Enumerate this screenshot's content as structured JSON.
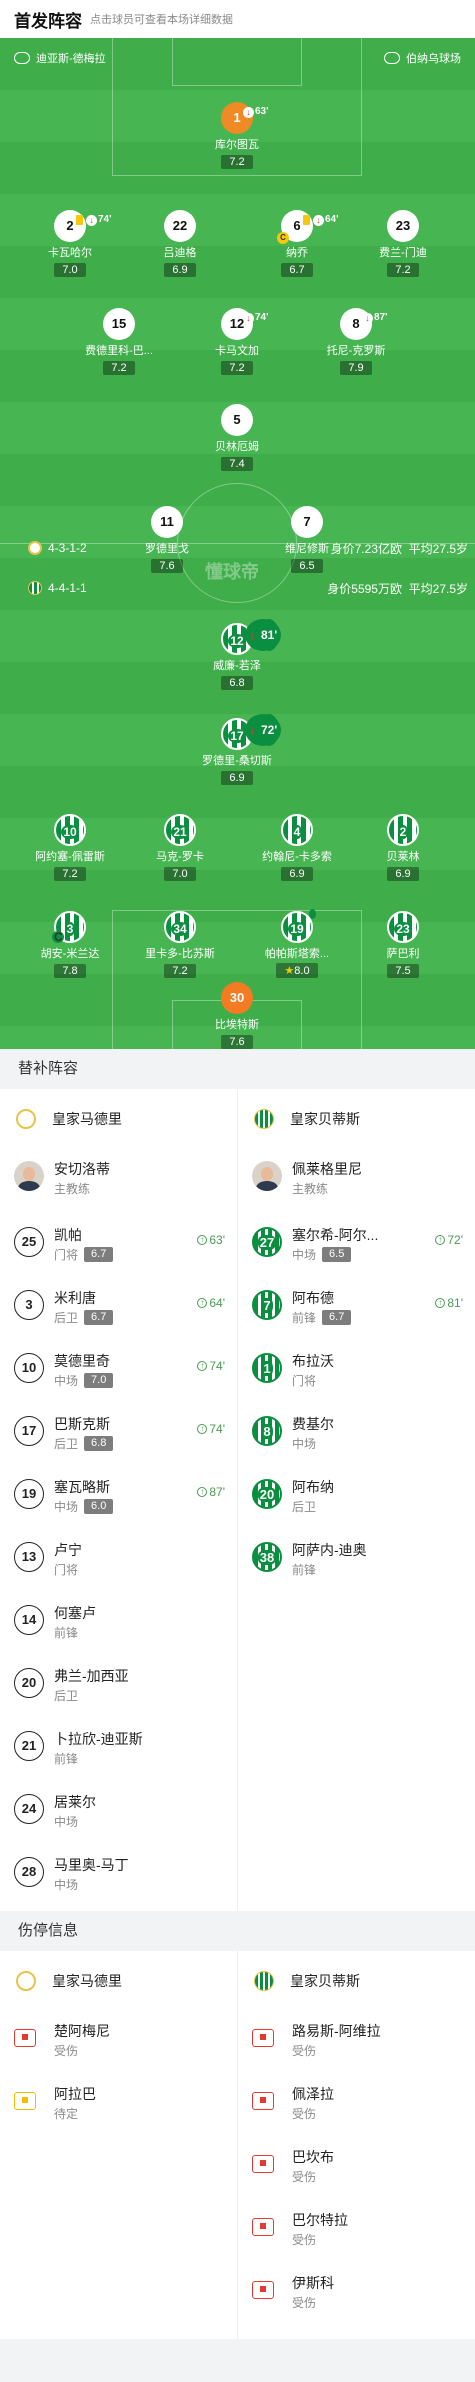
{
  "header": {
    "title": "首发阵容",
    "hint": "点击球员可查看本场详细数据"
  },
  "venues": {
    "left": "迪亚斯-德梅拉",
    "right": "伯纳乌球场"
  },
  "watermark": "懂球帝",
  "home_team": {
    "formation": "4-3-1-2",
    "value": "身价7.23亿欧",
    "age": "平均27.5岁"
  },
  "away_team": {
    "formation": "4-4-1-1",
    "value": "身价5595万欧",
    "age": "平均27.5岁"
  },
  "home_players": [
    {
      "num": "1",
      "name": "库尔图瓦",
      "rating": "7.2",
      "sub": "63'",
      "type": "gk"
    },
    {
      "num": "2",
      "name": "卡瓦哈尔",
      "rating": "7.0",
      "sub": "74'",
      "yellow": true
    },
    {
      "num": "22",
      "name": "吕迪格",
      "rating": "6.9"
    },
    {
      "num": "6",
      "name": "纳乔",
      "rating": "6.7",
      "sub": "64'",
      "yellow": true,
      "captain": "C"
    },
    {
      "num": "23",
      "name": "费兰-门迪",
      "rating": "7.2"
    },
    {
      "num": "15",
      "name": "费德里科-巴...",
      "rating": "7.2"
    },
    {
      "num": "12",
      "name": "卡马文加",
      "rating": "7.2",
      "sub": "74'"
    },
    {
      "num": "8",
      "name": "托尼-克罗斯",
      "rating": "7.9",
      "sub": "87'"
    },
    {
      "num": "5",
      "name": "贝林厄姆",
      "rating": "7.4"
    },
    {
      "num": "11",
      "name": "罗德里戈",
      "rating": "7.6"
    },
    {
      "num": "7",
      "name": "维尼修斯",
      "rating": "6.5"
    }
  ],
  "away_players": [
    {
      "num": "12",
      "name": "威廉-若泽",
      "rating": "6.8",
      "sub": "81'"
    },
    {
      "num": "17",
      "name": "罗德里-桑切斯",
      "rating": "6.9",
      "sub": "72'"
    },
    {
      "num": "10",
      "name": "阿约塞-佩雷斯",
      "rating": "7.2"
    },
    {
      "num": "21",
      "name": "马克-罗卡",
      "rating": "7.0"
    },
    {
      "num": "4",
      "name": "约翰尼-卡多索",
      "rating": "6.9"
    },
    {
      "num": "2",
      "name": "贝莱林",
      "rating": "6.9"
    },
    {
      "num": "3",
      "name": "胡安-米兰达",
      "rating": "7.8",
      "captain": "C"
    },
    {
      "num": "34",
      "name": "里卡多-比苏斯",
      "rating": "7.2"
    },
    {
      "num": "19",
      "name": "帕帕斯塔索...",
      "rating": "8.0",
      "yellow": true,
      "star": "★"
    },
    {
      "num": "23",
      "name": "萨巴利",
      "rating": "7.5"
    },
    {
      "num": "30",
      "name": "比埃特斯",
      "rating": "7.6",
      "type": "gk"
    }
  ],
  "subs_section": {
    "title": "替补阵容"
  },
  "subs": {
    "home_team": "皇家马德里",
    "away_team": "皇家贝蒂斯",
    "home_coach": {
      "name": "安切洛蒂",
      "role": "主教练"
    },
    "away_coach": {
      "name": "佩莱格里尼",
      "role": "主教练"
    },
    "home": [
      {
        "num": "25",
        "name": "凯帕",
        "pos": "门将",
        "rating": "6.7",
        "in": "63'"
      },
      {
        "num": "3",
        "name": "米利唐",
        "pos": "后卫",
        "rating": "6.7",
        "in": "64'"
      },
      {
        "num": "10",
        "name": "莫德里奇",
        "pos": "中场",
        "rating": "7.0",
        "in": "74'"
      },
      {
        "num": "17",
        "name": "巴斯克斯",
        "pos": "后卫",
        "rating": "6.8",
        "in": "74'"
      },
      {
        "num": "19",
        "name": "塞瓦略斯",
        "pos": "中场",
        "rating": "6.0",
        "in": "87'"
      },
      {
        "num": "13",
        "name": "卢宁",
        "pos": "门将"
      },
      {
        "num": "14",
        "name": "何塞卢",
        "pos": "前锋"
      },
      {
        "num": "20",
        "name": "弗兰-加西亚",
        "pos": "后卫"
      },
      {
        "num": "21",
        "name": "卜拉欣-迪亚斯",
        "pos": "前锋"
      },
      {
        "num": "24",
        "name": "居莱尔",
        "pos": "中场"
      },
      {
        "num": "28",
        "name": "马里奥-马丁",
        "pos": "中场"
      }
    ],
    "away": [
      {
        "num": "27",
        "name": "塞尔希-阿尔...",
        "pos": "中场",
        "rating": "6.5",
        "in": "72'"
      },
      {
        "num": "7",
        "name": "阿布德",
        "pos": "前锋",
        "rating": "6.7",
        "in": "81'"
      },
      {
        "num": "1",
        "name": "布拉沃",
        "pos": "门将"
      },
      {
        "num": "8",
        "name": "费基尔",
        "pos": "中场"
      },
      {
        "num": "20",
        "name": "阿布纳",
        "pos": "后卫"
      },
      {
        "num": "38",
        "name": "阿萨内-迪奥",
        "pos": "前锋"
      }
    ]
  },
  "injury_section": {
    "title": "伤停信息"
  },
  "injuries": {
    "home_team": "皇家马德里",
    "away_team": "皇家贝蒂斯",
    "home": [
      {
        "name": "楚阿梅尼",
        "status": "受伤",
        "kind": "injury"
      },
      {
        "name": "阿拉巴",
        "status": "待定",
        "kind": "doubt"
      }
    ],
    "away": [
      {
        "name": "路易斯-阿维拉",
        "status": "受伤",
        "kind": "injury"
      },
      {
        "name": "佩泽拉",
        "status": "受伤",
        "kind": "injury"
      },
      {
        "name": "巴坎布",
        "status": "受伤",
        "kind": "injury"
      },
      {
        "name": "巴尔特拉",
        "status": "受伤",
        "kind": "injury"
      },
      {
        "name": "伊斯科",
        "status": "受伤",
        "kind": "injury"
      }
    ]
  }
}
